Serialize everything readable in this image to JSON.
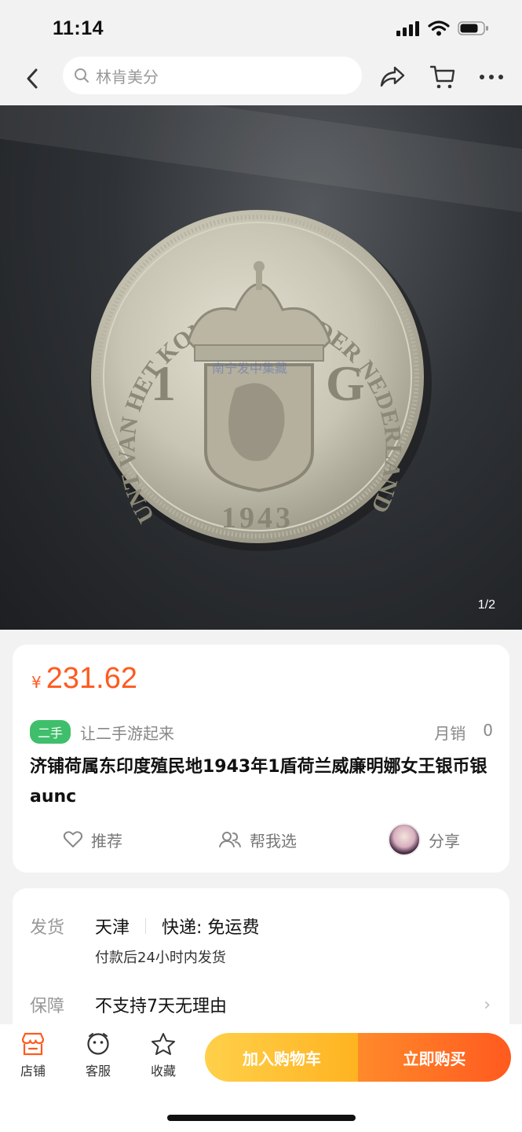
{
  "status_bar": {
    "time": "11:14"
  },
  "nav": {
    "search_placeholder": "林肯美分"
  },
  "gallery": {
    "counter": "1/2",
    "coin_text": {
      "legend": "MUNT VAN HET KONINGRIJK DER NEDERLANDEN",
      "denom_left": "1",
      "denom_right": "G",
      "year": "1943",
      "watermark": "南宁发中集藏"
    }
  },
  "product": {
    "currency": "¥",
    "price": "231.62",
    "badge": "二手",
    "slogan": "让二手游起来",
    "sales_label": "月销",
    "sales_value": "0",
    "title": "济铺荷属东印度殖民地1943年1盾荷兰威廉明娜女王银币银 aunc",
    "actions": {
      "recommend": "推荐",
      "help_choose": "帮我选",
      "share": "分享"
    }
  },
  "shipping": {
    "ship_label": "发货",
    "ship_from": "天津",
    "express": "快递: 免运费",
    "ship_time": "付款后24小时内发货",
    "guarantee_label": "保障",
    "guarantee": "不支持7天无理由"
  },
  "bottom_bar": {
    "store": "店铺",
    "service": "客服",
    "favorite": "收藏",
    "add_to_cart": "加入购物车",
    "buy_now": "立即购买"
  },
  "colors": {
    "accent": "#ff5a1f",
    "badge_green": "#3fbf6b",
    "cart_yellow": "#ffb321"
  }
}
